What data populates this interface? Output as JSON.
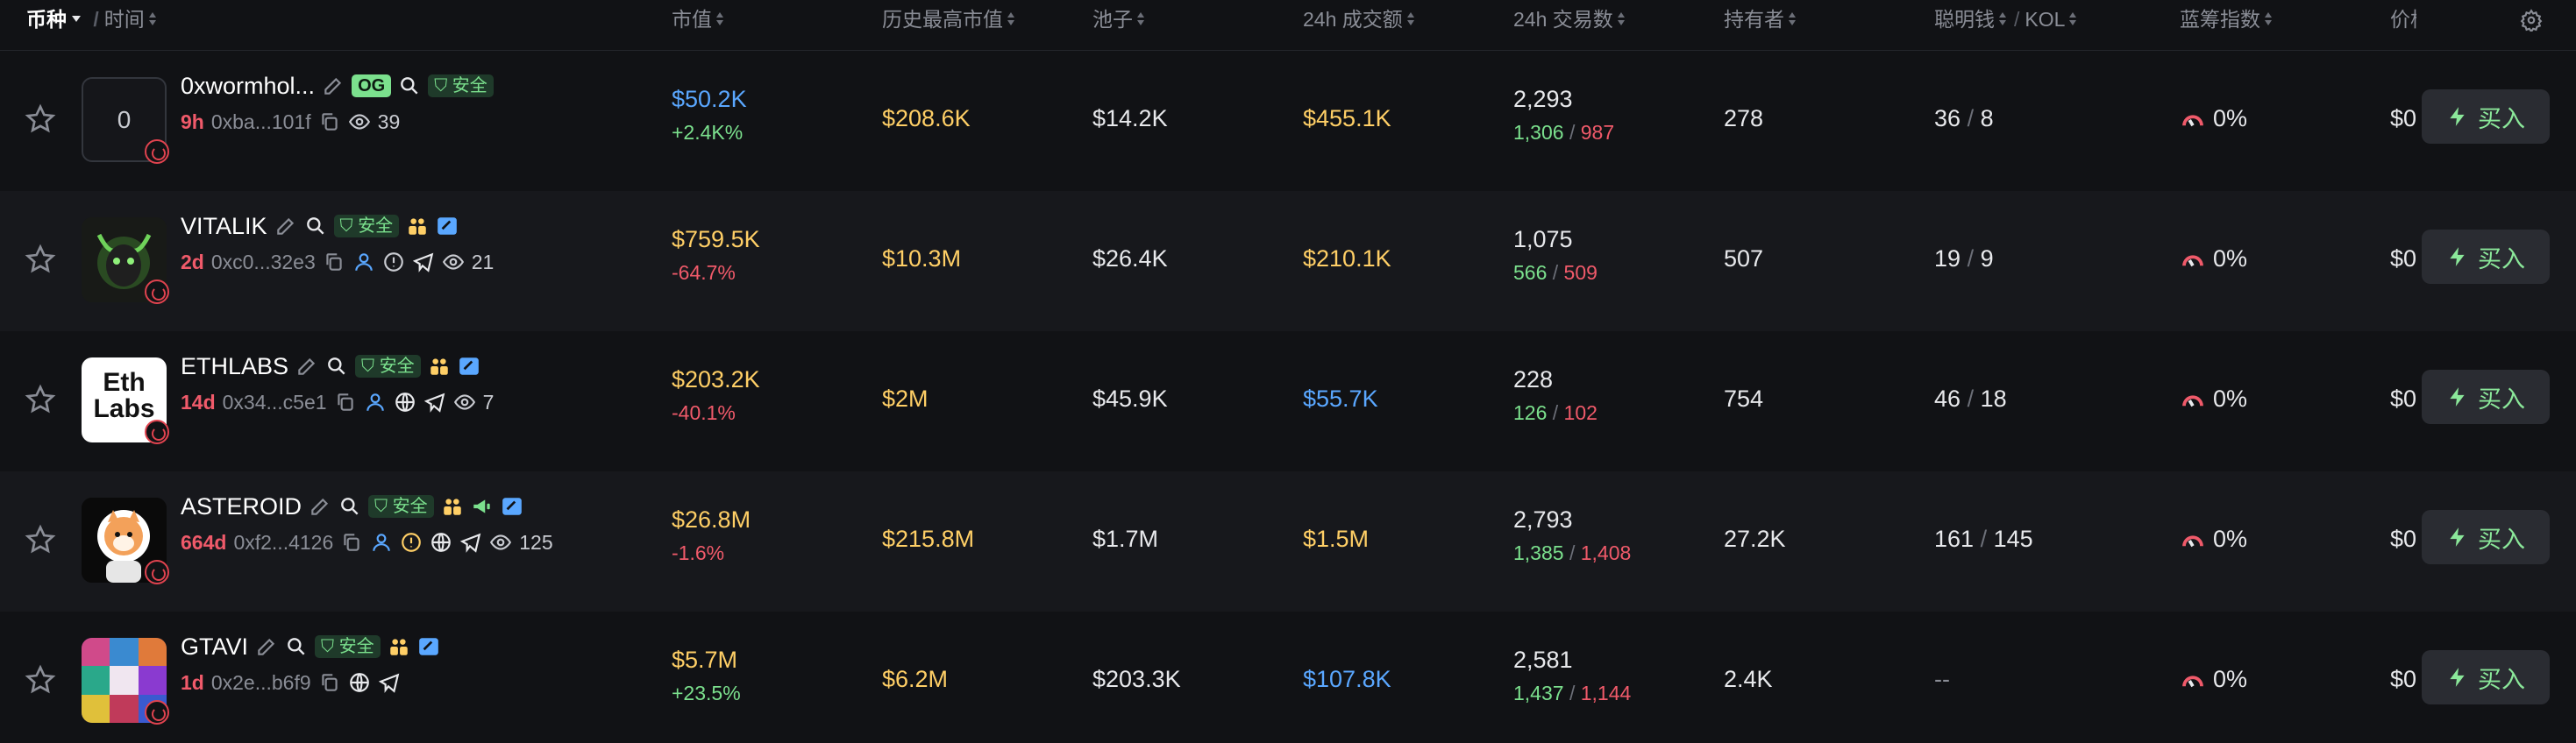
{
  "header": {
    "coin": "币种",
    "time": "时间",
    "mcap": "市值",
    "ath": "历史最高市值",
    "pool": "池子",
    "vol": "24h 成交额",
    "txs": "24h 交易数",
    "holders": "持有者",
    "smart": "聪明钱",
    "kol": "KOL",
    "bluechip": "蓝筹指数",
    "price": "价格",
    "settings_icon": "gear-icon"
  },
  "colors": {
    "background": "#111215",
    "alt_row": "#17181c",
    "green": "#7be08d",
    "red": "#f05a6a",
    "blue": "#5aa7ff",
    "yellow": "#ffcf66"
  },
  "rows": [
    {
      "avatar_text": "0",
      "name": "0xwormhol...",
      "og_tag": "OG",
      "safe": "安全",
      "age": "9h",
      "address": "0xba...101f",
      "views": "39",
      "mcap": "$50.2K",
      "change": "+2.4K%",
      "ath": "$208.6K",
      "pool": "$14.2K",
      "vol": "$455.1K",
      "txs": "2,293",
      "buys": "1,306",
      "sells": "987",
      "holders": "278",
      "smart": "36",
      "kol": "8",
      "bluechip": "0%",
      "price": "$0",
      "buy": "买入"
    },
    {
      "name": "VITALIK",
      "safe": "安全",
      "age": "2d",
      "address": "0xc0...32e3",
      "views": "21",
      "mcap": "$759.5K",
      "change": "-64.7%",
      "ath": "$10.3M",
      "pool": "$26.4K",
      "vol": "$210.1K",
      "txs": "1,075",
      "buys": "566",
      "sells": "509",
      "holders": "507",
      "smart": "19",
      "kol": "9",
      "bluechip": "0%",
      "price": "$0",
      "buy": "买入"
    },
    {
      "avatar_line1": "Eth",
      "avatar_line2": "Labs",
      "name": "ETHLABS",
      "safe": "安全",
      "age": "14d",
      "address": "0x34...c5e1",
      "views": "7",
      "mcap": "$203.2K",
      "change": "-40.1%",
      "ath": "$2M",
      "pool": "$45.9K",
      "vol": "$55.7K",
      "txs": "228",
      "buys": "126",
      "sells": "102",
      "holders": "754",
      "smart": "46",
      "kol": "18",
      "bluechip": "0%",
      "price": "$0",
      "buy": "买入"
    },
    {
      "name": "ASTEROID",
      "safe": "安全",
      "age": "664d",
      "address": "0xf2...4126",
      "views": "125",
      "mcap": "$26.8M",
      "change": "-1.6%",
      "ath": "$215.8M",
      "pool": "$1.7M",
      "vol": "$1.5M",
      "txs": "2,793",
      "buys": "1,385",
      "sells": "1,408",
      "holders": "27.2K",
      "smart": "161",
      "kol": "145",
      "bluechip": "0%",
      "price": "$0",
      "buy": "买入"
    },
    {
      "name": "GTAVI",
      "safe": "安全",
      "age": "1d",
      "address": "0x2e...b6f9",
      "mcap": "$5.7M",
      "change": "+23.5%",
      "ath": "$6.2M",
      "pool": "$203.3K",
      "vol": "$107.8K",
      "txs": "2,581",
      "buys": "1,437",
      "sells": "1,144",
      "holders": "2.4K",
      "smart_kol": "--",
      "bluechip": "0%",
      "price": "$0",
      "buy": "买入"
    }
  ]
}
